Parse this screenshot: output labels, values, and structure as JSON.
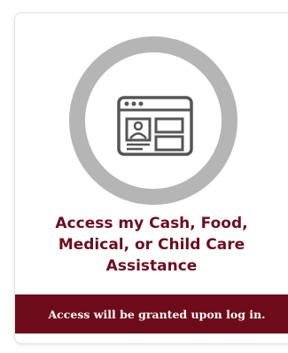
{
  "card": {
    "title_line1": "Access my Cash, Food,",
    "title_line2": "Medical, or Child Care",
    "title_line3": "Assistance",
    "banner_text": "Access will be granted upon log in."
  },
  "colors": {
    "accent": "#6e0b1a",
    "icon_ring": "#b5b5b5",
    "icon_fill": "#555555"
  },
  "icons": {
    "main": "profile-window-icon"
  }
}
